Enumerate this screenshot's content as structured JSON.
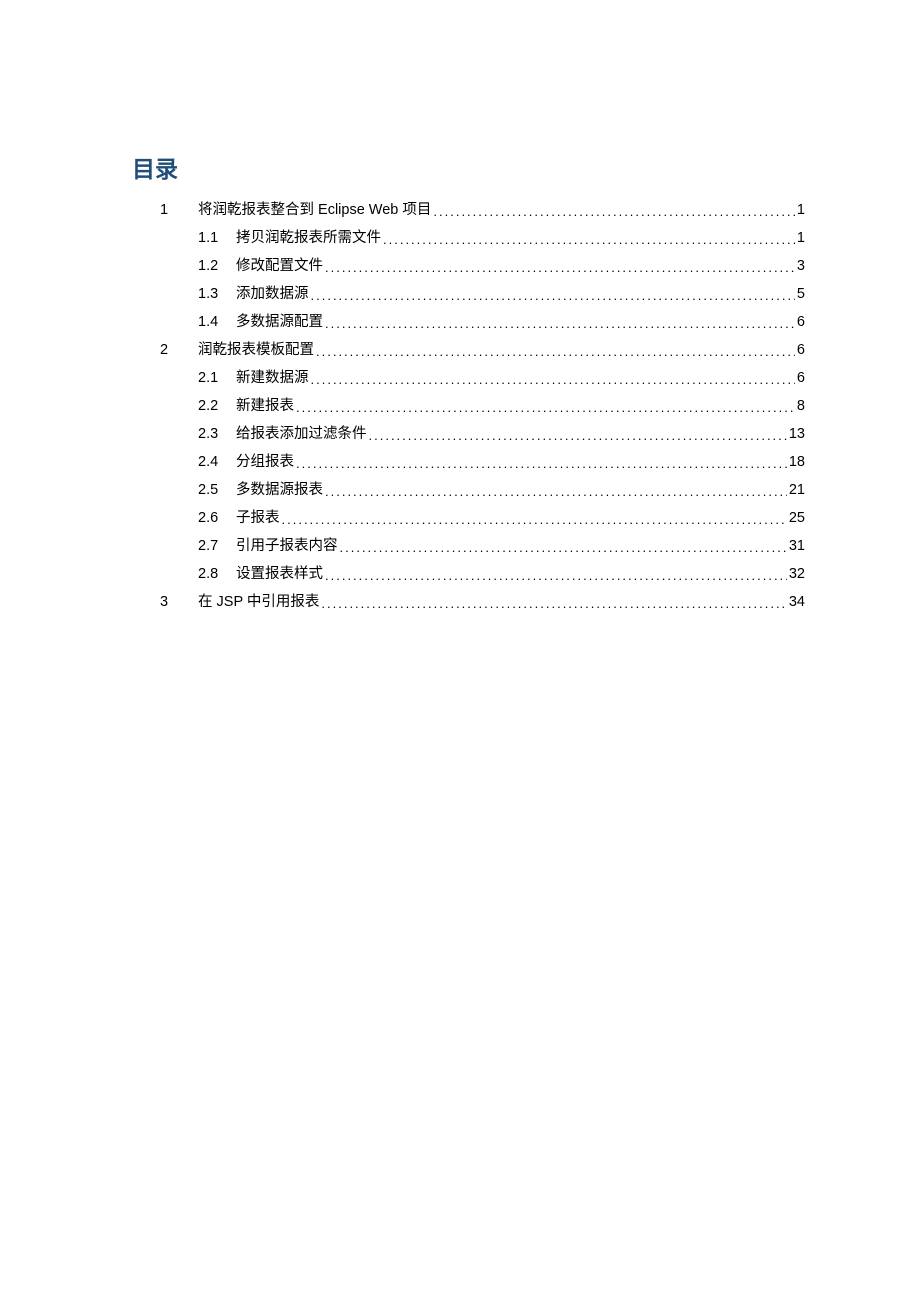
{
  "title": "目录",
  "toc": [
    {
      "level": 1,
      "num": "1",
      "label": "将润乾报表整合到 Eclipse Web 项目",
      "page": "1"
    },
    {
      "level": 2,
      "num": "1.1",
      "label": "拷贝润乾报表所需文件",
      "page": "1"
    },
    {
      "level": 2,
      "num": "1.2",
      "label": "修改配置文件",
      "page": "3"
    },
    {
      "level": 2,
      "num": "1.3",
      "label": "添加数据源",
      "page": "5"
    },
    {
      "level": 2,
      "num": "1.4",
      "label": "多数据源配置",
      "page": "6"
    },
    {
      "level": 1,
      "num": "2",
      "label": "润乾报表模板配置",
      "page": "6"
    },
    {
      "level": 2,
      "num": "2.1",
      "label": "新建数据源",
      "page": "6"
    },
    {
      "level": 2,
      "num": "2.2",
      "label": "新建报表",
      "page": "8"
    },
    {
      "level": 2,
      "num": "2.3",
      "label": "给报表添加过滤条件",
      "page": "13"
    },
    {
      "level": 2,
      "num": "2.4",
      "label": "分组报表",
      "page": "18"
    },
    {
      "level": 2,
      "num": "2.5",
      "label": "多数据源报表",
      "page": "21"
    },
    {
      "level": 2,
      "num": "2.6",
      "label": "子报表",
      "page": "25"
    },
    {
      "level": 2,
      "num": "2.7",
      "label": "引用子报表内容",
      "page": "31"
    },
    {
      "level": 2,
      "num": "2.8",
      "label": "设置报表样式",
      "page": "32"
    },
    {
      "level": 1,
      "num": "3",
      "label": "在 JSP 中引用报表",
      "page": "34"
    }
  ]
}
